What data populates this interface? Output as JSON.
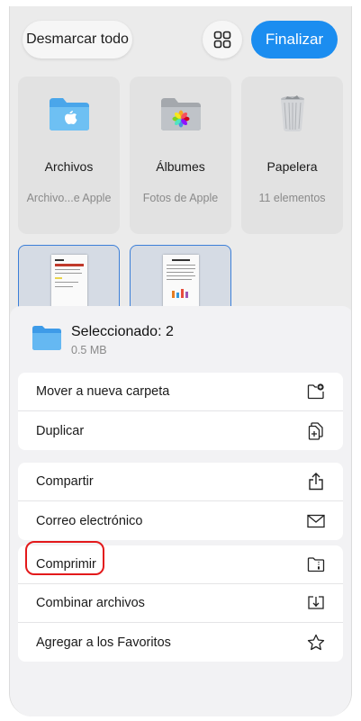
{
  "toolbar": {
    "deselect_label": "Desmarcar todo",
    "finish_label": "Finalizar"
  },
  "folders": [
    {
      "name": "Archivos",
      "subtitle": "Archivo...e Apple"
    },
    {
      "name": "Álbumes",
      "subtitle": "Fotos de Apple"
    },
    {
      "name": "Papelera",
      "subtitle": "11 elementos"
    }
  ],
  "sheet": {
    "title": "Seleccionado: 2",
    "size": "0.5 MB",
    "group1": [
      {
        "label": "Mover a nueva carpeta",
        "icon": "folder-plus-icon"
      },
      {
        "label": "Duplicar",
        "icon": "duplicate-icon"
      }
    ],
    "group2": [
      {
        "label": "Compartir",
        "icon": "share-icon"
      },
      {
        "label": "Correo electrónico",
        "icon": "mail-icon"
      }
    ],
    "group3": [
      {
        "label": "Comprimir",
        "icon": "zip-folder-icon"
      },
      {
        "label": "Combinar archivos",
        "icon": "merge-icon"
      },
      {
        "label": "Agregar a los Favoritos",
        "icon": "star-icon"
      }
    ]
  },
  "colors": {
    "accent": "#1b8df0",
    "highlight": "#e3191b",
    "folder_blue": "#5fb3ee"
  }
}
